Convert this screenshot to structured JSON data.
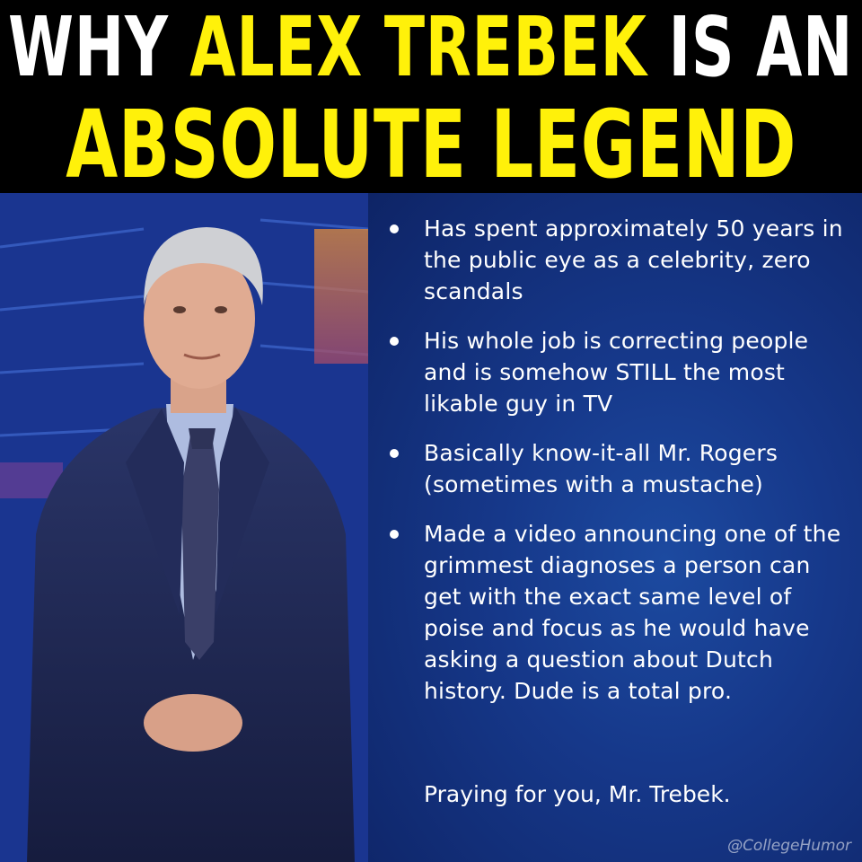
{
  "header": {
    "line1": {
      "part1": "WHY ",
      "highlight": "ALEX TREBEK",
      "part2": " IS AN"
    },
    "line2": "ABSOLUTE LEGEND",
    "colors": {
      "white": "#ffffff",
      "yellow": "#fff10a",
      "background": "#000000"
    }
  },
  "photo": {
    "subject": "man in navy suit and patterned tie on a blue studio set"
  },
  "bullets": [
    {
      "text": "Has spent approximately 50 years in the public eye as a celebrity, zero scandals"
    },
    {
      "text": "His whole job is correcting people and is somehow STILL the most likable guy in TV"
    },
    {
      "text": "Basically know-it-all Mr. Rogers (sometimes with a mustache)"
    },
    {
      "text": "Made a video announcing one of the grimmest diagnoses a person can get with the exact same level of poise and focus as he would have asking a question about Dutch history. Dude is a total pro."
    }
  ],
  "closing": "Praying for you, Mr. Trebek.",
  "watermark": "@CollegeHumor",
  "colors": {
    "panel_blue": "#16388a",
    "text": "#ffffff"
  }
}
